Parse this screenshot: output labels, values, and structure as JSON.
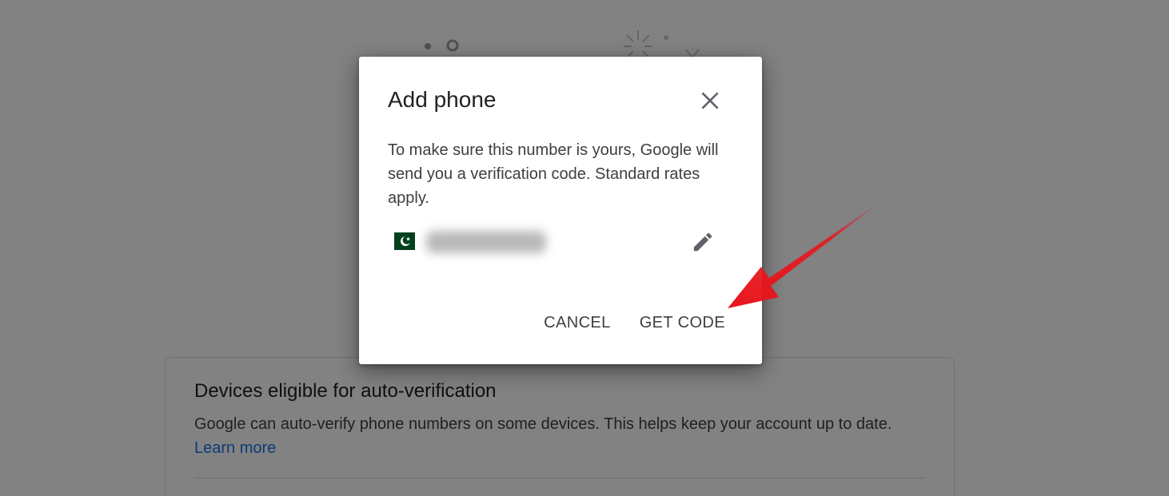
{
  "background": {
    "card": {
      "title": "Devices eligible for auto-verification",
      "description": "Google can auto-verify phone numbers on some devices. This helps keep your account up to date.",
      "link_label": "Learn more"
    }
  },
  "dialog": {
    "title": "Add phone",
    "close_icon": "close-icon",
    "body": "To make sure this number is yours, Google will send you a verification code. Standard rates apply.",
    "phone": {
      "flag_icon": "pakistan-flag-icon",
      "number": "",
      "edit_icon": "pencil-icon"
    },
    "actions": {
      "cancel_label": "CANCEL",
      "get_code_label": "GET CODE"
    }
  },
  "colors": {
    "scrim": "#7f7f7f",
    "text_primary": "#202124",
    "text_secondary": "#3c4043",
    "link": "#1a73e8",
    "flag_green": "#01411c",
    "arrow_red": "#e8141b"
  }
}
